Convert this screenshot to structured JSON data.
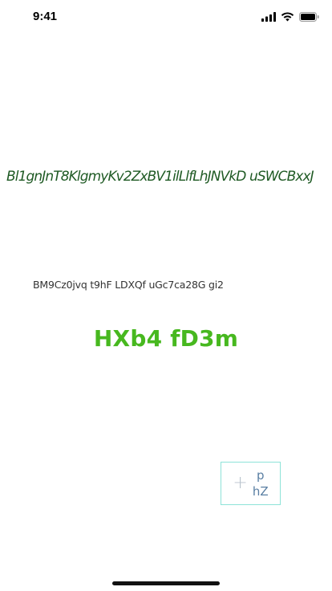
{
  "status_bar": {
    "time": "9:41",
    "icons": [
      "signal-icon",
      "wifi-icon",
      "battery-icon"
    ]
  },
  "main": {
    "italic_line": "Bl1gnJnT8KlgmyKv2ZxBV1ilLlfLhJNVkD uSWCBxxJ",
    "small_line": "BM9Cz0jvq t9hF LDXQf uGc7ca28G gi2",
    "heading": "HXb4 fD3m"
  },
  "add_button": {
    "icon": "plus-icon",
    "label_top": "p",
    "label_bottom": "hZ",
    "border_color": "#8ee3d8"
  },
  "colors": {
    "italic_text": "#1f5a24",
    "heading": "#47b81f",
    "button_text": "#5a7fa3"
  }
}
